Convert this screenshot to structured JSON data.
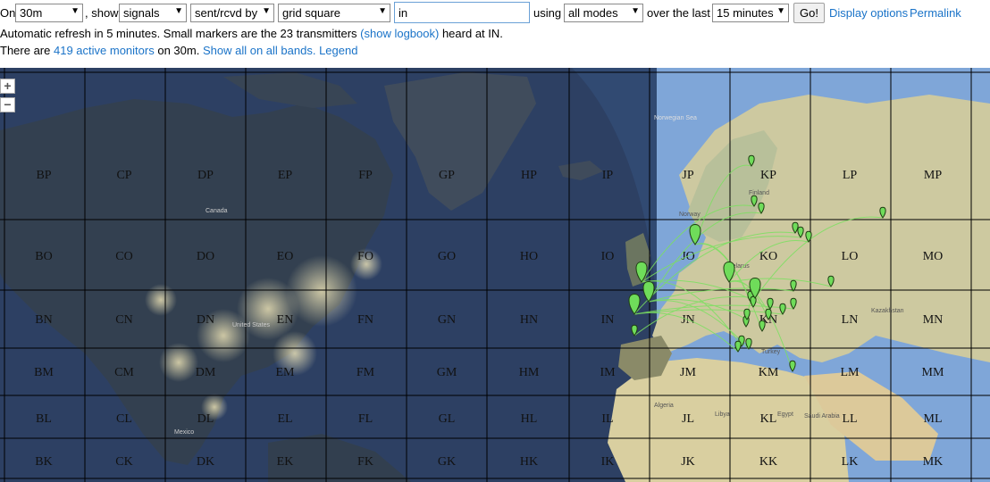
{
  "controls": {
    "on_label": "On",
    "band": "30m",
    "show_label": ", show",
    "show_what": "signals",
    "direction": "sent/rcvd by",
    "filter_type": "grid square",
    "filter_value": "in",
    "using_label": "using",
    "modes": "all modes",
    "over_label": "over the last",
    "period": "15 minutes",
    "go_label": "Go!",
    "display_options": "Display options",
    "permalink": "Permalink"
  },
  "status": {
    "line1_a": "Automatic refresh in 5 minutes. Small markers are the 23 transmitters",
    "show_logbook": "(show logbook)",
    "line1_b": "heard at IN.",
    "line2_a": "There are",
    "active_monitors": "419 active monitors",
    "line2_b": "on 30m.",
    "show_all": "Show all on all bands.",
    "legend": "Legend"
  },
  "map": {
    "zoom_in": "+",
    "zoom_out": "−",
    "grid_columns": [
      "BP",
      "CP",
      "DP",
      "EP",
      "FP",
      "GP",
      "HP",
      "IP",
      "JP",
      "KP",
      "LP",
      "MP"
    ],
    "grid_rows": [
      [
        "BP",
        "CP",
        "DP",
        "EP",
        "FP",
        "GP",
        "HP",
        "IP",
        "JP",
        "KP",
        "LP",
        "MP"
      ],
      [
        "BO",
        "CO",
        "DO",
        "EO",
        "FO",
        "GO",
        "HO",
        "IO",
        "JO",
        "KO",
        "LO",
        "MO"
      ],
      [
        "BN",
        "CN",
        "DN",
        "EN",
        "FN",
        "GN",
        "HN",
        "IN",
        "JN",
        "KN",
        "LN",
        "MN"
      ],
      [
        "BM",
        "CM",
        "DM",
        "EM",
        "FM",
        "GM",
        "HM",
        "IM",
        "JM",
        "KM",
        "LM",
        "MM"
      ],
      [
        "BL",
        "CL",
        "DL",
        "EL",
        "FL",
        "GL",
        "HL",
        "IL",
        "JL",
        "KL",
        "LL",
        "ML"
      ],
      [
        "BK",
        "CK",
        "DK",
        "EK",
        "FK",
        "GK",
        "HK",
        "IK",
        "JK",
        "KK",
        "LK",
        "MK"
      ]
    ],
    "place_labels": {
      "norwegian_sea": "Norwegian Sea",
      "canada": "Canada",
      "finland": "Finland",
      "norway": "Norway",
      "belarus": "Belarus",
      "turkey": "Turkey",
      "kazakhstan": "Kazakhstan",
      "algeria": "Algeria",
      "libya": "Libya",
      "egypt": "Egypt",
      "saudi_arabia": "Saudi Arabia",
      "mexico": "Mexico",
      "united_states": "United States"
    },
    "colors": {
      "ocean": "#324a70",
      "night": "#26344f",
      "land_day": "#d9d6b3",
      "marker": "#6fdc5a"
    }
  }
}
